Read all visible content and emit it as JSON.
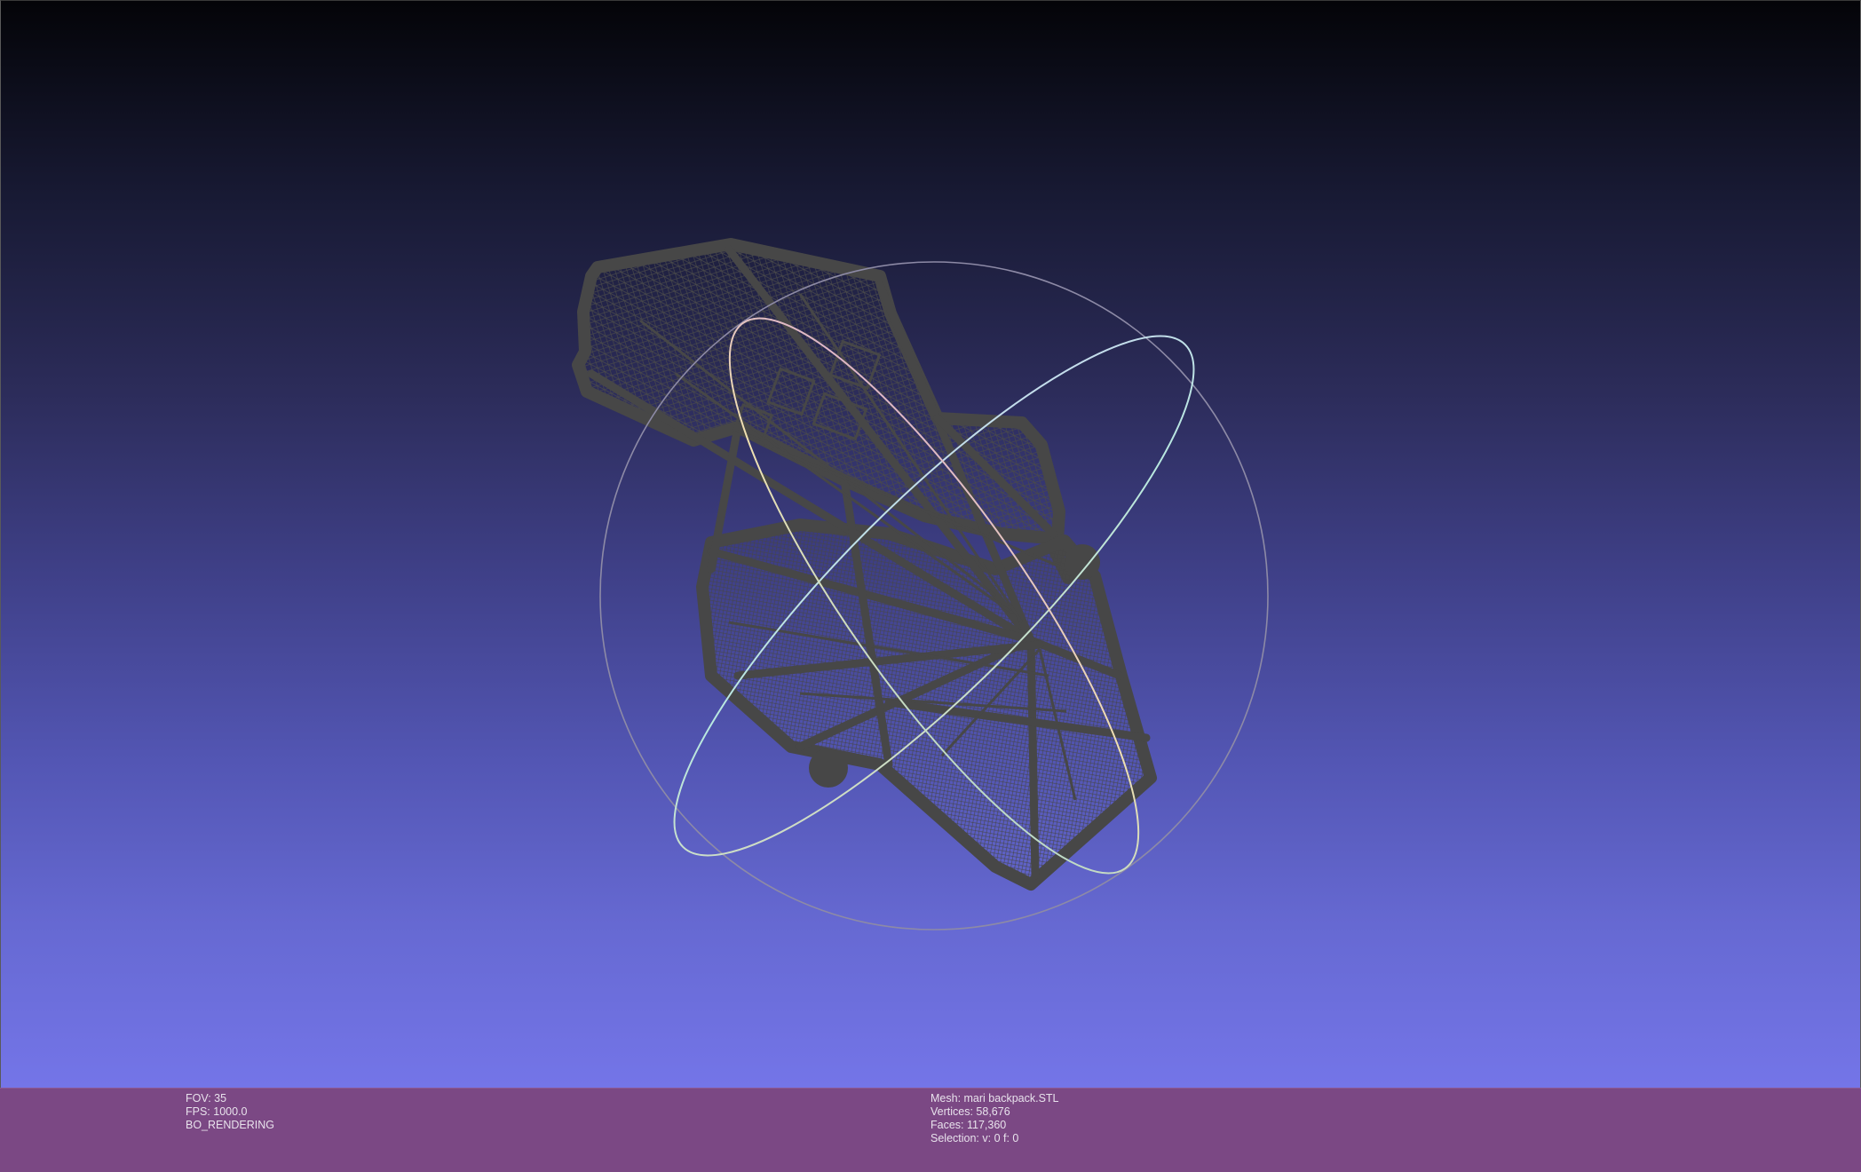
{
  "viewer": {
    "background_top_color": "#040408",
    "background_bottom_color": "#7475e8",
    "info_bar_color": "#7b4884",
    "mesh_color": "#474747"
  },
  "render_info": {
    "fov": "FOV: 35",
    "fps": "FPS:  1000.0",
    "mode": "BO_RENDERING"
  },
  "mesh_info": {
    "mesh": "Mesh: mari backpack.STL",
    "vertices": "Vertices: 58,676",
    "faces": "Faces: 117,360",
    "selection": "Selection: v: 0 f: 0"
  },
  "trackball": {
    "icon": "trackball-icon"
  }
}
